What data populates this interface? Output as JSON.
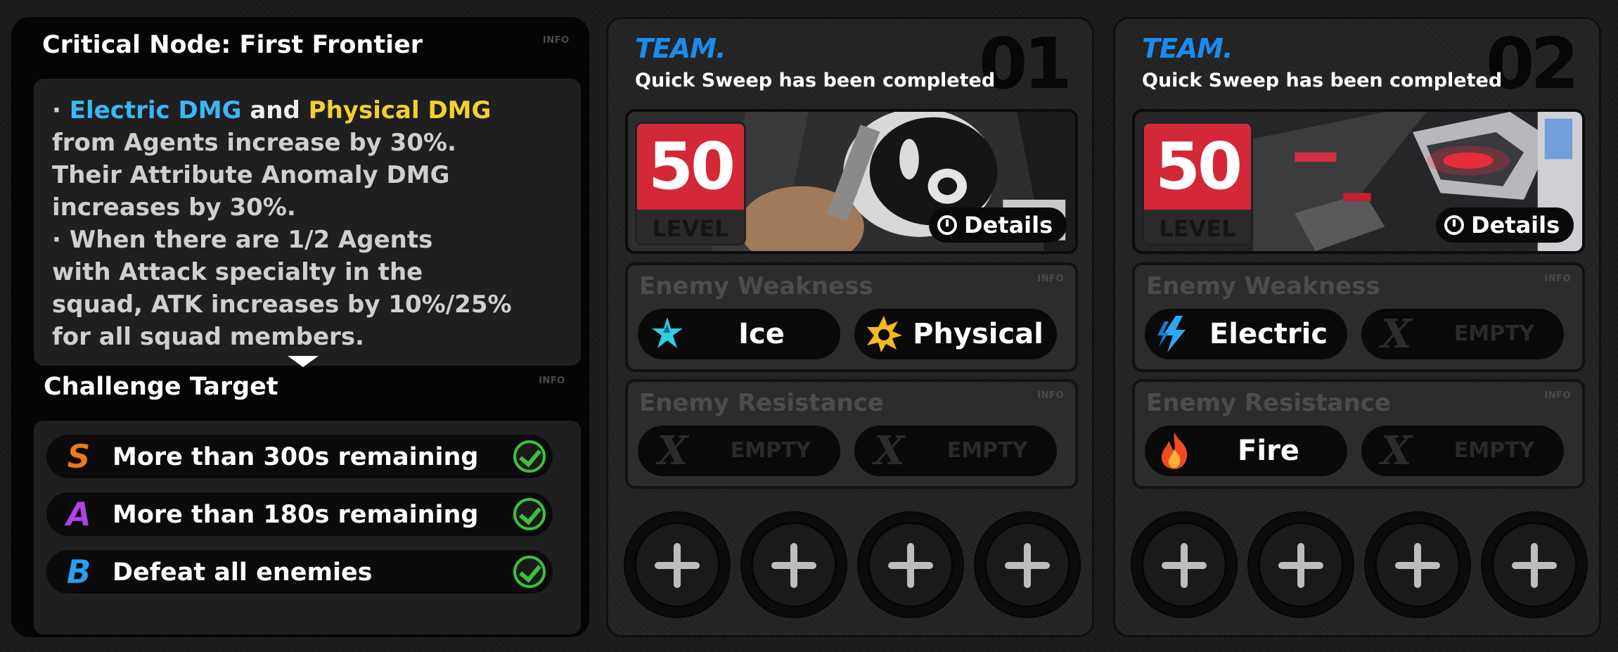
{
  "node": {
    "title": "Critical Node: First Frontier",
    "info_label": "INFO",
    "description": {
      "bullet": "·",
      "line1_electric": "Electric DMG",
      "line1_and": " and ",
      "line1_physical": "Physical DMG",
      "line2": "from Agents increase by 30%.",
      "line3": "Their Attribute Anomaly DMG",
      "line4": "increases by 30%.",
      "line5": "When there are 1/2 Agents",
      "line6": "with Attack specialty in the",
      "line7": "squad, ATK increases by 10%/25%",
      "line8": "for all squad members."
    }
  },
  "challenge": {
    "title": "Challenge Target",
    "info_label": "INFO",
    "targets": [
      {
        "grade": "S",
        "text": "More than 300s remaining",
        "completed": true,
        "color": "#f07a1a"
      },
      {
        "grade": "A",
        "text": "More than 180s remaining",
        "completed": true,
        "color": "#b044e8"
      },
      {
        "grade": "B",
        "text": "Defeat all enemies",
        "completed": true,
        "color": "#2a9ef0"
      }
    ]
  },
  "teams": [
    {
      "label": "TEAM.",
      "number": "01",
      "status": "Quick Sweep has been completed",
      "level": "50",
      "level_label": "LEVEL",
      "details_label": "Details",
      "weakness_title": "Enemy Weakness",
      "resistance_title": "Enemy Resistance",
      "info_label": "INFO",
      "weakness": [
        {
          "name": "Ice",
          "icon": "ice-icon"
        },
        {
          "name": "Physical",
          "icon": "physical-icon"
        }
      ],
      "resistance": [
        {
          "name": "EMPTY",
          "icon": "empty-x-icon"
        },
        {
          "name": "EMPTY",
          "icon": "empty-x-icon"
        }
      ]
    },
    {
      "label": "TEAM.",
      "number": "02",
      "status": "Quick Sweep has been completed",
      "level": "50",
      "level_label": "LEVEL",
      "details_label": "Details",
      "weakness_title": "Enemy Weakness",
      "resistance_title": "Enemy Resistance",
      "info_label": "INFO",
      "weakness": [
        {
          "name": "Electric",
          "icon": "electric-icon"
        },
        {
          "name": "EMPTY",
          "icon": "empty-x-icon"
        }
      ],
      "resistance": [
        {
          "name": "Fire",
          "icon": "fire-icon"
        },
        {
          "name": "EMPTY",
          "icon": "empty-x-icon"
        }
      ]
    }
  ],
  "colors": {
    "team_blue": "#1a8cf0",
    "level_red": "#d32838",
    "electric": "#3cb6f5",
    "physical": "#f2cf31",
    "check_green": "#3fbf3f"
  }
}
